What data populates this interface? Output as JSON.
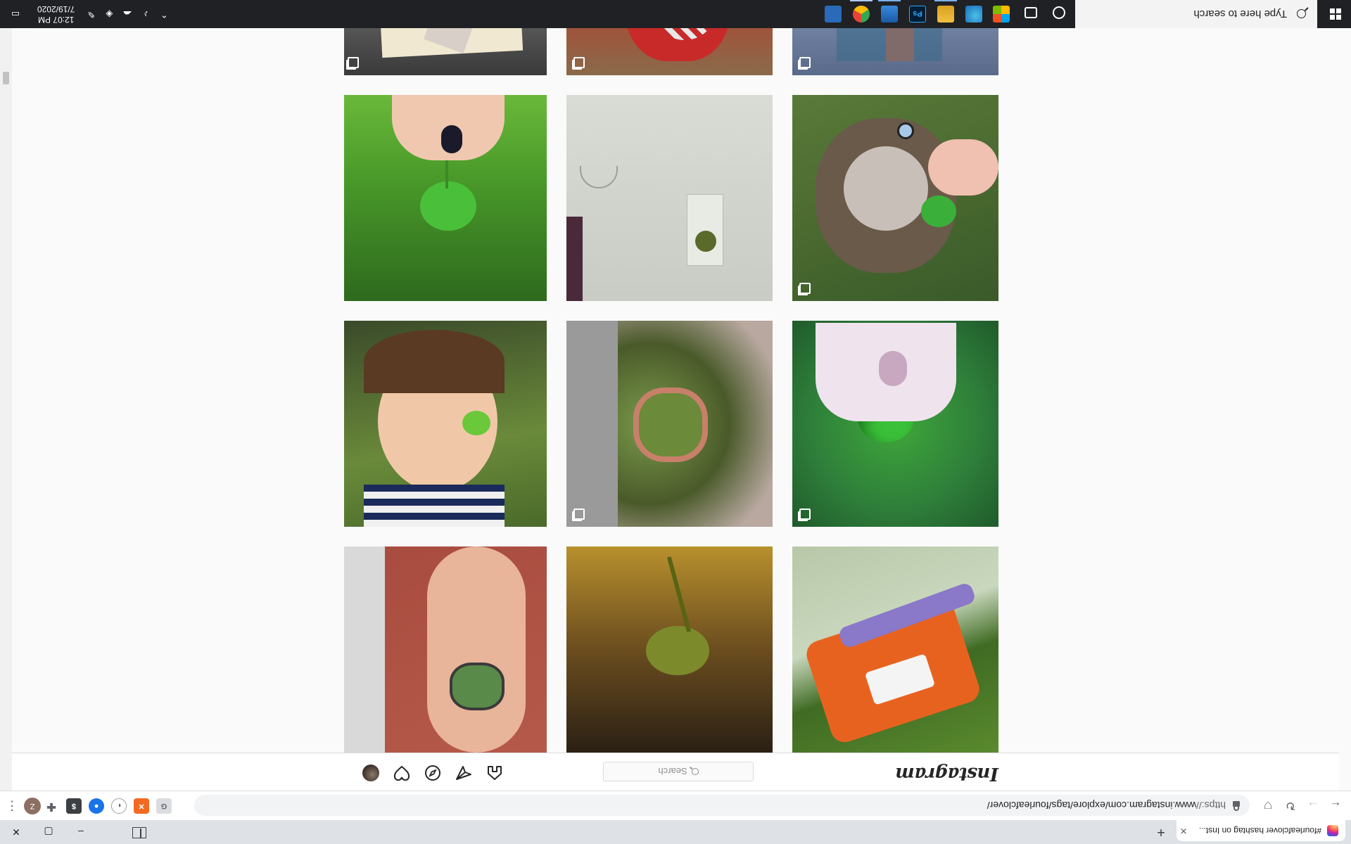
{
  "browser": {
    "tab_title": "#fourleafclover hashtag on Inst...",
    "new_tab": "+",
    "win_min": "–",
    "win_max": "▢",
    "win_close": "✕",
    "url_scheme": "https://",
    "url_host_path": "www.instagram.com/explore/tags/fourleafclover/",
    "profile_initial": "Z"
  },
  "instagram": {
    "logo": "Instagram",
    "search_placeholder": "Search"
  },
  "taskbar": {
    "search_placeholder": "Type here to search",
    "time": "12:07 PM",
    "date": "7/19/2020"
  }
}
